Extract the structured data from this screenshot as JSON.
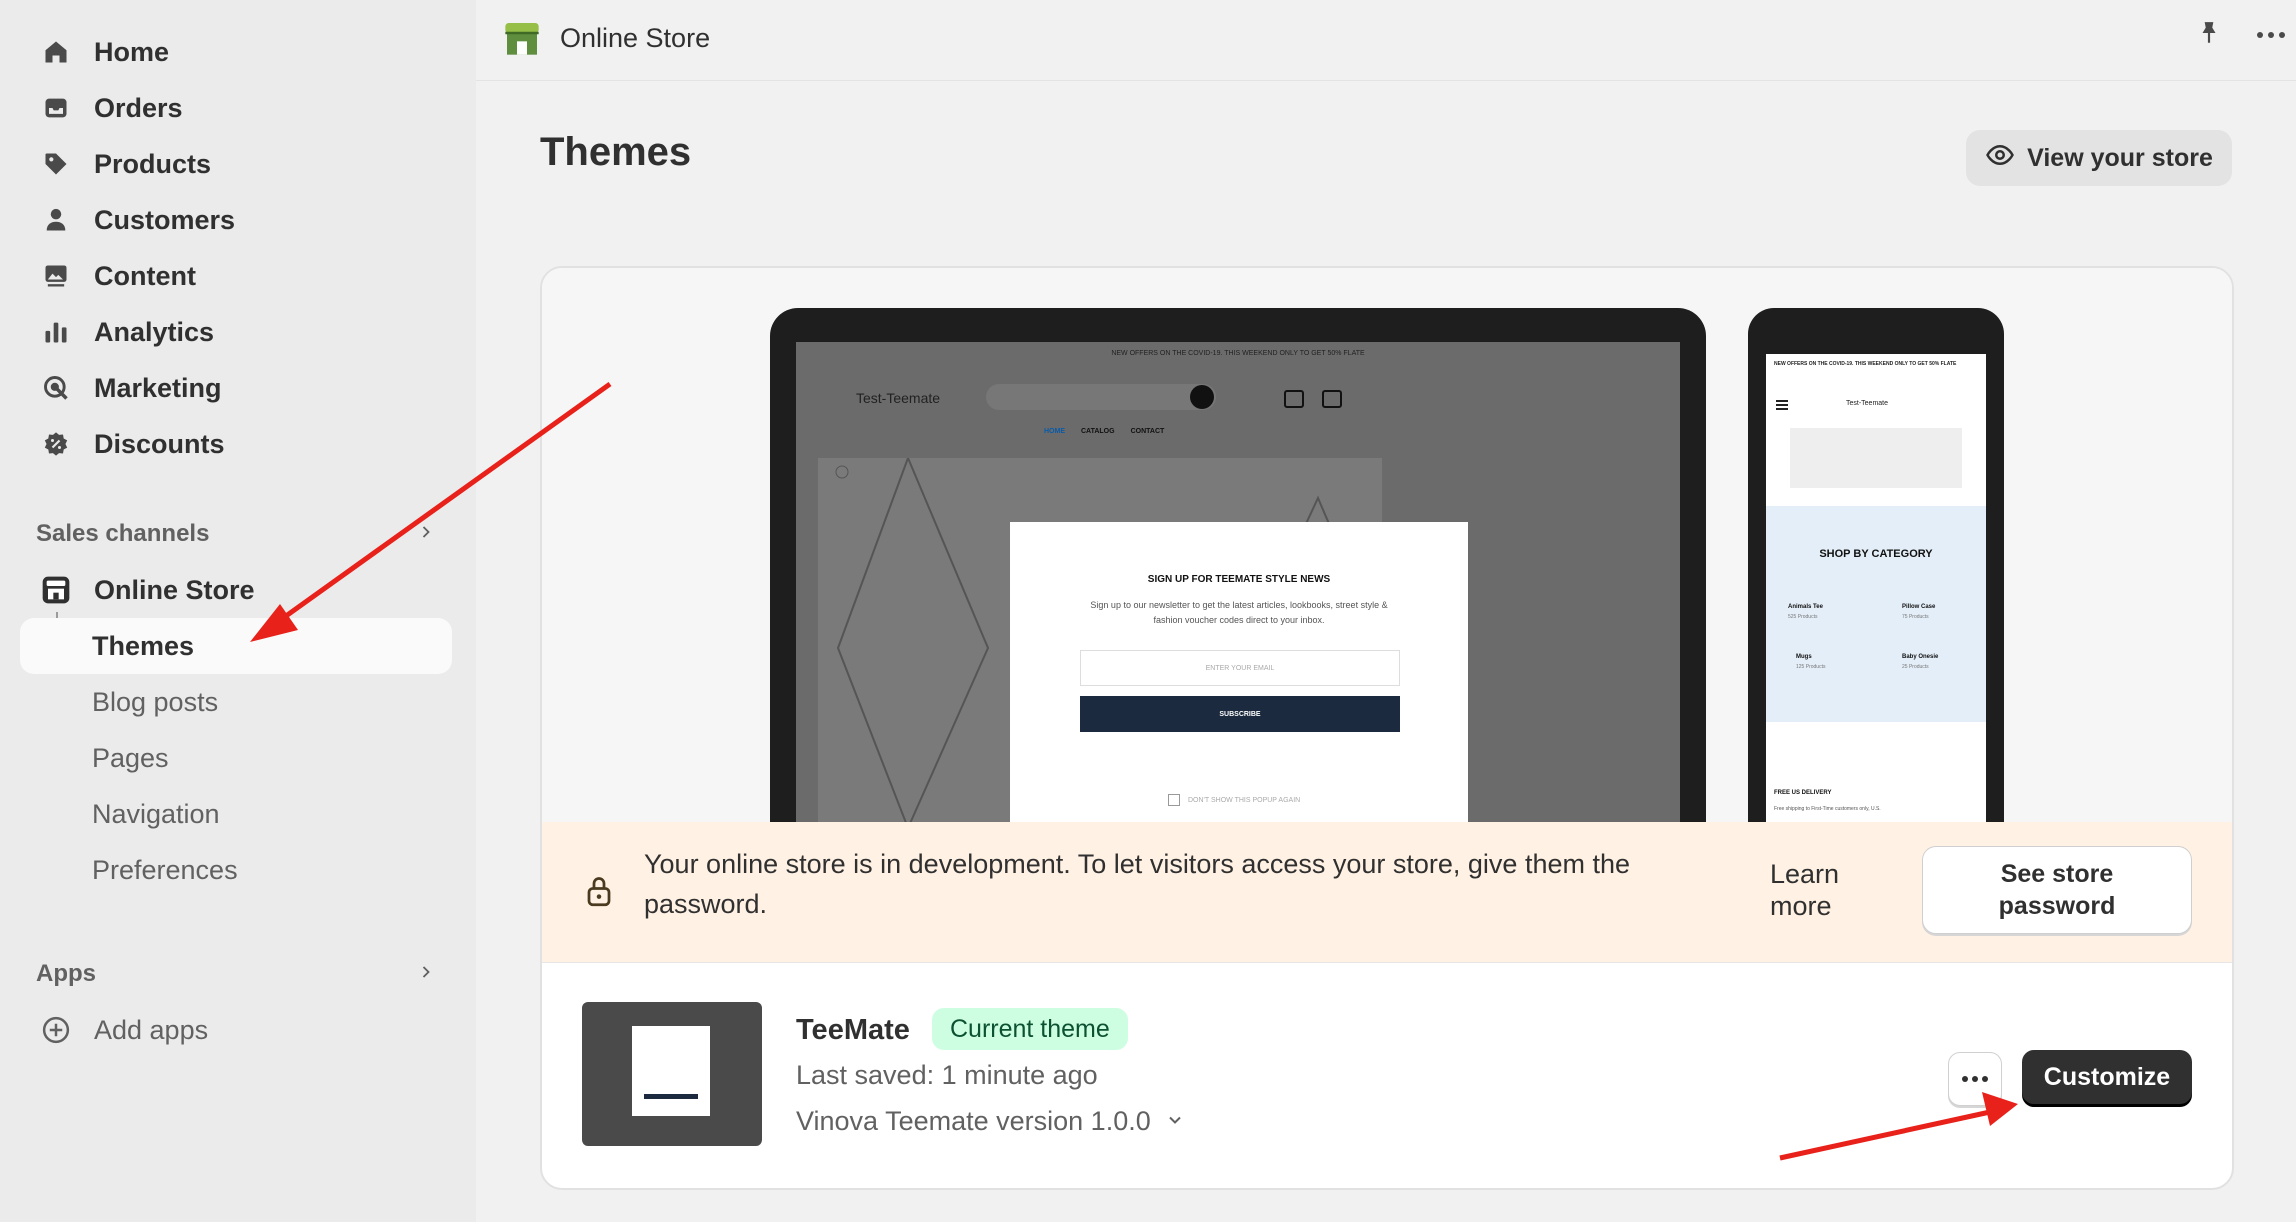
{
  "sidebar": {
    "main_items": [
      {
        "label": "Home",
        "icon": "home-icon"
      },
      {
        "label": "Orders",
        "icon": "inbox-icon"
      },
      {
        "label": "Products",
        "icon": "tag-icon"
      },
      {
        "label": "Customers",
        "icon": "person-icon"
      },
      {
        "label": "Content",
        "icon": "image-icon"
      },
      {
        "label": "Analytics",
        "icon": "bar-chart-icon"
      },
      {
        "label": "Marketing",
        "icon": "target-icon"
      },
      {
        "label": "Discounts",
        "icon": "discount-icon"
      }
    ],
    "sales_channels_heading": "Sales channels",
    "online_store_label": "Online Store",
    "sub_items": [
      "Themes",
      "Blog posts",
      "Pages",
      "Navigation",
      "Preferences"
    ],
    "active_sub_item": "Themes",
    "apps_heading": "Apps",
    "add_apps_label": "Add apps"
  },
  "topbar": {
    "title": "Online Store"
  },
  "main": {
    "page_title": "Themes",
    "view_store_label": "View your store"
  },
  "preview": {
    "announcement": "NEW OFFERS ON THE COVID-19. THIS WEEKEND ONLY TO GET 50% FLATE",
    "store_name": "Test-Teemate",
    "nav": [
      "HOME",
      "CATALOG",
      "CONTACT"
    ],
    "popup_title": "SIGN UP FOR TEEMATE STYLE NEWS",
    "popup_text": "Sign up to our newsletter to get the latest articles, lookbooks, street style & fashion voucher codes direct to your inbox.",
    "popup_input_placeholder": "ENTER YOUR EMAIL",
    "popup_button": "SUBSCRIBE",
    "popup_checkbox": "DON'T SHOW THIS POPUP AGAIN",
    "phone_announcement": "NEW OFFERS ON THE COVID-19. THIS WEEKEND ONLY TO GET 50% FLATE",
    "phone_store_name": "Test-Teemate",
    "shop_by_category": "SHOP BY CATEGORY",
    "categories": [
      {
        "name": "Animals Tee",
        "count": "525 Products"
      },
      {
        "name": "Pillow Case",
        "count": "75 Products"
      },
      {
        "name": "Mugs",
        "count": "125 Products"
      },
      {
        "name": "Baby Onesie",
        "count": "25 Products"
      }
    ],
    "free_delivery": "FREE US DELIVERY",
    "free_delivery_text": "Free shipping to First-Time customers only, U.S."
  },
  "banner": {
    "message": "Your online store is in development. To let visitors access your store, give them the password.",
    "learn_more": "Learn more",
    "button": "See store password"
  },
  "theme": {
    "name": "TeeMate",
    "badge": "Current theme",
    "last_saved": "Last saved: 1 minute ago",
    "version": "Vinova Teemate version 1.0.0",
    "customize_label": "Customize"
  },
  "colors": {
    "annotation_arrow": "#e8211a",
    "badge_bg": "#cdfee1",
    "banner_bg": "#fff1e3",
    "primary_button": "#303030"
  }
}
